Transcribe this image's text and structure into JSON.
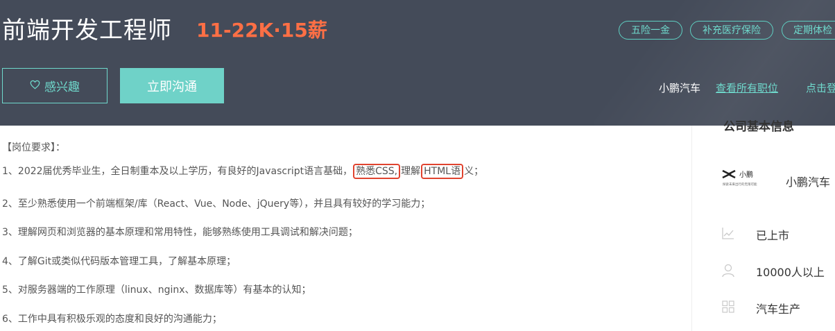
{
  "job": {
    "title": "前端开发工程师",
    "salary": "11-22K·15薪"
  },
  "tags": [
    "五险一金",
    "补充医疗保险",
    "定期体检"
  ],
  "actions": {
    "interest_label": "感兴趣",
    "chat_label": "立即沟通"
  },
  "company_bar": {
    "name": "小鹏汽车",
    "all_jobs_link": "查看所有职位",
    "login_link": "点击登"
  },
  "requirements": {
    "heading": "【岗位要求】：",
    "line1": {
      "pre": "1、2022届优秀毕业生，全日制重本及以上学历，有良好的Javascript语言基础，",
      "hl1": "熟悉CSS,",
      "mid": "理解",
      "hl2": "HTML语",
      "post": "义；"
    },
    "items": [
      "2、至少熟悉使用一个前端框架/库（React、Vue、Node、jQuery等），并且具有较好的学习能力；",
      "3、理解网页和浏览器的基本原理和常用特性，能够熟练使用工具调试和解决问题；",
      "4、了解Git或类似代码版本管理工具，了解基本原理；",
      "5、对服务器端的工作原理（linux、nginx、数据库等）有基本的认知；",
      "6、工作中具有积极乐观的态度和良好的沟通能力；"
    ]
  },
  "company_info": {
    "title": "公司基本信息",
    "logo_text": "小鹏",
    "logo_subtext": "探索未来出行的无限可能",
    "company_name": "小鹏汽车",
    "listing_status": "已上市",
    "size": "10000人以上",
    "industry": "汽车生产"
  },
  "colors": {
    "header_bg": "#444b59",
    "accent": "#6fdacd",
    "salary": "#fd6f45",
    "highlight_box": "#e0432f"
  }
}
